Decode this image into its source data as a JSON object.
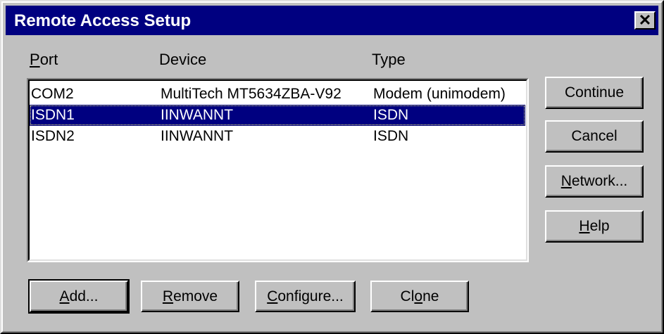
{
  "window": {
    "title": "Remote Access Setup",
    "close_glyph": "✕"
  },
  "columns": {
    "port_mnemonic": "P",
    "port_rest": "ort",
    "device": "Device",
    "type": "Type"
  },
  "rows": [
    {
      "port": "COM2",
      "device": "MultiTech MT5634ZBA-V92",
      "type": "Modem (unimodem)",
      "selected": false
    },
    {
      "port": "ISDN1",
      "device": "IINWANNT",
      "type": "ISDN",
      "selected": true
    },
    {
      "port": "ISDN2",
      "device": "IINWANNT",
      "type": "ISDN",
      "selected": false
    }
  ],
  "side_buttons": {
    "continue": "Continue",
    "cancel": "Cancel",
    "network_mnemonic": "N",
    "network_rest": "etwork...",
    "help_mnemonic": "H",
    "help_rest": "elp"
  },
  "bottom_buttons": {
    "add_mnemonic": "A",
    "add_rest": "dd...",
    "remove_mnemonic": "R",
    "remove_rest": "emove",
    "configure_mnemonic": "C",
    "configure_rest": "onfigure...",
    "clone_pre": "Cl",
    "clone_mnemonic": "o",
    "clone_rest": "ne"
  },
  "colors": {
    "face": "#c0c0c0",
    "titlebar": "#000080",
    "selection": "#000080"
  }
}
